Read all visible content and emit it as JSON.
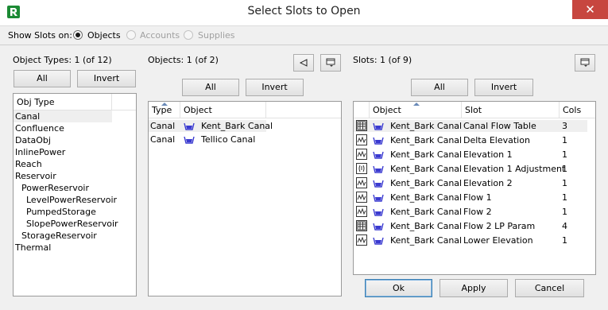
{
  "window": {
    "title": "Select Slots to Open",
    "close_glyph": "✕"
  },
  "show_slots": {
    "label": "Show Slots on:",
    "options": [
      {
        "label": "Objects",
        "selected": true,
        "enabled": true
      },
      {
        "label": "Accounts",
        "selected": false,
        "enabled": false
      },
      {
        "label": "Supplies",
        "selected": false,
        "enabled": false
      }
    ]
  },
  "object_types": {
    "header": "Object Types: 1 (of 12)",
    "all_label": "All",
    "invert_label": "Invert",
    "column": "Obj Type",
    "items": [
      "Canal",
      "Confluence",
      "DataObj",
      "InlinePower",
      "Reach",
      "Reservoir",
      "PowerReservoir",
      "LevelPowerReservoir",
      "PumpedStorage",
      "SlopePowerReservoir",
      "StorageReservoir",
      "Thermal"
    ]
  },
  "objects": {
    "header": "Objects: 1 (of 2)",
    "all_label": "All",
    "invert_label": "Invert",
    "columns": [
      "Type",
      "Object"
    ],
    "rows": [
      {
        "type": "Canal",
        "object": "Kent_Bark Canal"
      },
      {
        "type": "Canal",
        "object": "Tellico Canal"
      }
    ]
  },
  "slots": {
    "header": "Slots: 1 (of 9)",
    "all_label": "All",
    "invert_label": "Invert",
    "columns": [
      "Object",
      "Slot",
      "Cols"
    ],
    "rows": [
      {
        "icon": "table-slot-icon",
        "object": "Kent_Bark Canal",
        "slot": "Canal Flow Table",
        "cols": "3"
      },
      {
        "icon": "series-slot-icon",
        "object": "Kent_Bark Canal",
        "slot": "Delta Elevation",
        "cols": "1"
      },
      {
        "icon": "series-slot-icon",
        "object": "Kent_Bark Canal",
        "slot": "Elevation 1",
        "cols": "1"
      },
      {
        "icon": "adjust-slot-icon",
        "object": "Kent_Bark Canal",
        "slot": "Elevation 1 Adjustment",
        "cols": "1"
      },
      {
        "icon": "series-slot-icon",
        "object": "Kent_Bark Canal",
        "slot": "Elevation 2",
        "cols": "1"
      },
      {
        "icon": "series-slot-icon",
        "object": "Kent_Bark Canal",
        "slot": "Flow 1",
        "cols": "1"
      },
      {
        "icon": "series-slot-icon",
        "object": "Kent_Bark Canal",
        "slot": "Flow 2",
        "cols": "1"
      },
      {
        "icon": "table-slot-icon",
        "object": "Kent_Bark Canal",
        "slot": "Flow 2 LP Param",
        "cols": "4"
      },
      {
        "icon": "series-slot-icon",
        "object": "Kent_Bark Canal",
        "slot": "Lower Elevation",
        "cols": "1"
      }
    ]
  },
  "footer": {
    "ok_label": "Ok",
    "apply_label": "Apply",
    "cancel_label": "Cancel"
  },
  "colors": {
    "accent": "#3c7fb1",
    "canal_icon": "#3a3ad0",
    "close_bg": "#c7463f",
    "app_icon": "#1b8a34"
  }
}
